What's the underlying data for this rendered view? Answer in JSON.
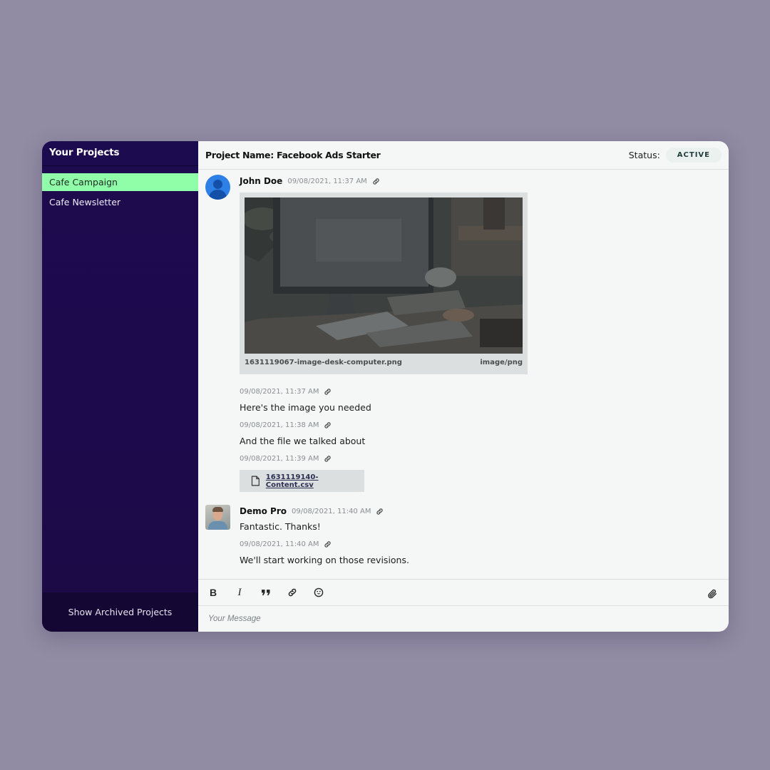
{
  "colors": {
    "background": "#918ba3",
    "sidebar": "#1d0b4f",
    "active_project": "#90fda9",
    "main_bg": "#f5f7f6",
    "status_badge_bg": "#eaf1ee"
  },
  "sidebar": {
    "title": "Your Projects",
    "projects": [
      {
        "label": "Cafe Campaign",
        "active": true
      },
      {
        "label": "Cafe Newsletter",
        "active": false
      }
    ],
    "footer_button": "Show Archived Projects"
  },
  "header": {
    "project_name": "Project Name: Facebook Ads Starter",
    "status_label": "Status:",
    "status_value": "ACTIVE"
  },
  "messages": [
    {
      "author": "John Doe",
      "timestamp": "09/08/2021, 11:37 AM",
      "avatar": "default-user-icon",
      "attachment_image": {
        "filename": "1631119067-image-desk-computer.png",
        "mime": "image/png"
      }
    },
    {
      "timestamp": "09/08/2021, 11:37 AM",
      "text": "Here's the image you needed"
    },
    {
      "timestamp": "09/08/2021, 11:38 AM",
      "text": "And the file we talked about"
    },
    {
      "timestamp": "09/08/2021, 11:39 AM",
      "attachment_file": {
        "filename": "1631119140-Content.csv",
        "icon": "file-icon"
      }
    },
    {
      "author": "Demo Pro",
      "timestamp": "09/08/2021, 11:40 AM",
      "avatar": "user-photo",
      "text": "Fantastic. Thanks!"
    },
    {
      "timestamp": "09/08/2021, 11:40 AM",
      "text": "We'll start working on those revisions."
    }
  ],
  "composer": {
    "tools": [
      "bold-icon",
      "italic-icon",
      "quote-icon",
      "link-icon",
      "emoji-icon"
    ],
    "bold_glyph": "B",
    "italic_glyph": "I",
    "attach_icon": "paperclip-icon",
    "placeholder": "Your Message"
  }
}
